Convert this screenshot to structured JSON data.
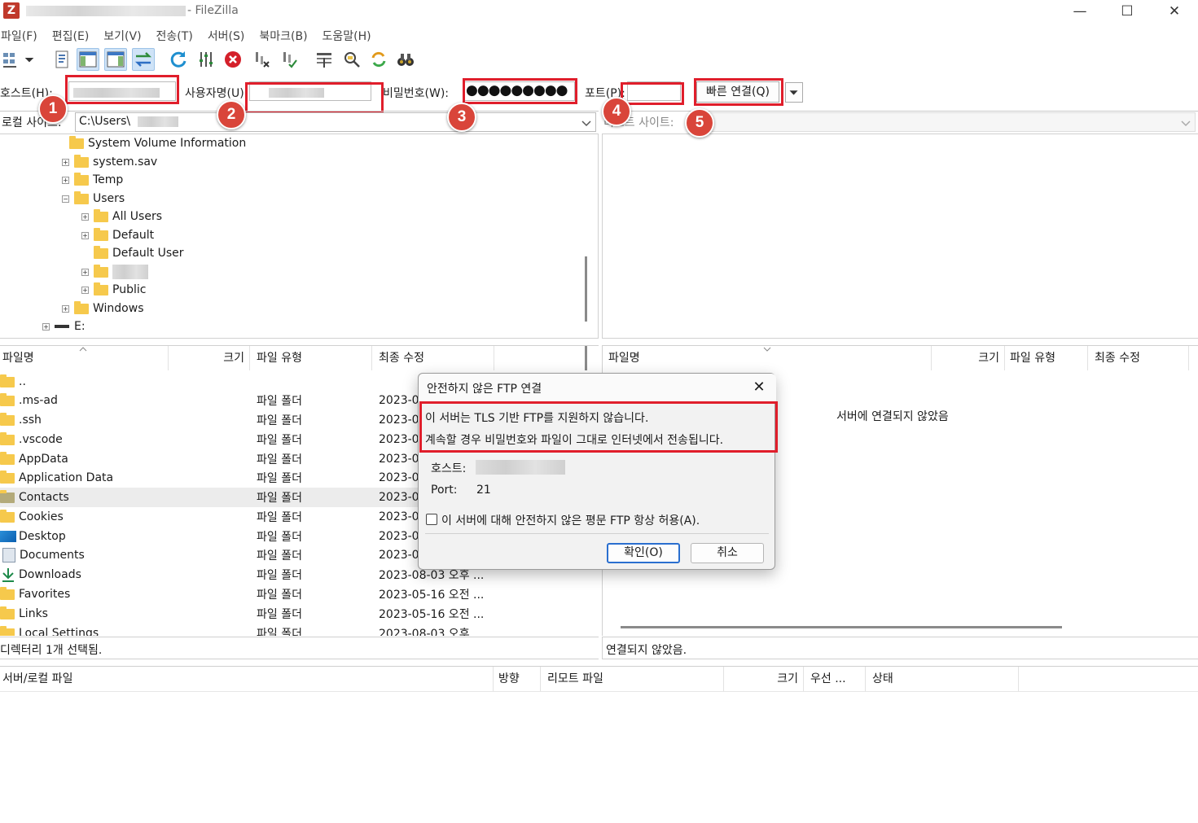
{
  "window": {
    "title": "- FileZilla",
    "logo": "Z",
    "controls": {
      "minimize": "—",
      "maximize": "☐",
      "close": "✕"
    }
  },
  "menu": [
    "파일(F)",
    "편집(E)",
    "보기(V)",
    "전송(T)",
    "서버(S)",
    "북마크(B)",
    "도움말(H)"
  ],
  "toolbar": {
    "icons": [
      "site-manager-icon",
      "dropdown-arrow-icon",
      "message-log-icon",
      "local-tree-icon",
      "remote-tree-icon",
      "transfer-queue-icon",
      "refresh-icon",
      "process-queue-icon",
      "cancel-icon",
      "disconnect-icon",
      "reconnect-icon",
      "directory-listing-filter-icon",
      "toggle-sync-icon",
      "sync-browse-icon",
      "search-icon"
    ]
  },
  "quickconnect": {
    "host_label": "호스트(H):",
    "user_label": "사용자명(U):",
    "password_label": "비밀번호(W):",
    "password_value": "●●●●●●●●●",
    "port_label": "포트(P):",
    "connect_button": "빠른 연결(Q)"
  },
  "badges": [
    "1",
    "2",
    "3",
    "4",
    "5"
  ],
  "local": {
    "site_label": "로컬 사이트:",
    "path": "C:\\Users\\",
    "tree": [
      {
        "label": "System Volume Information",
        "level": 1,
        "expander": ""
      },
      {
        "label": "system.sav",
        "level": 1,
        "expander": "+"
      },
      {
        "label": "Temp",
        "level": 1,
        "expander": "+"
      },
      {
        "label": "Users",
        "level": 1,
        "expander": "−"
      },
      {
        "label": "All Users",
        "level": 2,
        "expander": "+"
      },
      {
        "label": "Default",
        "level": 2,
        "expander": "+"
      },
      {
        "label": "Default User",
        "level": 2,
        "expander": ""
      },
      {
        "label": "",
        "level": 2,
        "expander": "+"
      },
      {
        "label": "Public",
        "level": 2,
        "expander": "+"
      },
      {
        "label": "Windows",
        "level": 1,
        "expander": "+"
      },
      {
        "label": "E:",
        "level": 0,
        "expander": "+"
      }
    ],
    "columns": {
      "name": "파일명",
      "size": "크기",
      "type": "파일 유형",
      "modified": "최종 수정"
    },
    "files": [
      {
        "name": "..",
        "type": "",
        "date": "",
        "icon": "folder-icon"
      },
      {
        "name": ".ms-ad",
        "type": "파일 폴더",
        "date": "2023-0",
        "icon": "folder-icon"
      },
      {
        "name": ".ssh",
        "type": "파일 폴더",
        "date": "2023-0",
        "icon": "folder-icon"
      },
      {
        "name": ".vscode",
        "type": "파일 폴더",
        "date": "2023-0",
        "icon": "folder-icon"
      },
      {
        "name": "AppData",
        "type": "파일 폴더",
        "date": "2023-0",
        "icon": "folder-icon"
      },
      {
        "name": "Application Data",
        "type": "파일 폴더",
        "date": "2023-0",
        "icon": "folder-icon"
      },
      {
        "name": "Contacts",
        "type": "파일 폴더",
        "date": "2023-0",
        "icon": "contacts-folder-icon"
      },
      {
        "name": "Cookies",
        "type": "파일 폴더",
        "date": "2023-0",
        "icon": "folder-icon"
      },
      {
        "name": "Desktop",
        "type": "파일 폴더",
        "date": "2023-0",
        "icon": "desktop-folder-icon"
      },
      {
        "name": "Documents",
        "type": "파일 폴더",
        "date": "2023-0",
        "icon": "documents-folder-icon"
      },
      {
        "name": "Downloads",
        "type": "파일 폴더",
        "date": "2023-08-03 오후 ...",
        "icon": "downloads-folder-icon"
      },
      {
        "name": "Favorites",
        "type": "파일 폴더",
        "date": "2023-05-16 오전 ...",
        "icon": "folder-icon"
      },
      {
        "name": "Links",
        "type": "파일 폴더",
        "date": "2023-05-16 오전 ...",
        "icon": "folder-icon"
      },
      {
        "name": "Local Settings",
        "type": "파일 폴더",
        "date": "2023-08-03 오후",
        "icon": "folder-icon"
      }
    ],
    "status": "디렉터리 1개 선택됨."
  },
  "remote": {
    "site_label": "리모트 사이트:",
    "columns": {
      "name": "파일명",
      "size": "크기",
      "type": "파일 유형",
      "modified": "최종 수정"
    },
    "empty_message": "서버에 연결되지 않았음",
    "status": "연결되지 않았음."
  },
  "queue": {
    "columns": {
      "file": "서버/로컬 파일",
      "direction": "방향",
      "remote": "리모트 파일",
      "size": "크기",
      "priority": "우선 ...",
      "status": "상태"
    }
  },
  "dialog": {
    "title": "안전하지 않은 FTP 연결",
    "line1": "이 서버는 TLS 기반 FTP를 지원하지 않습니다.",
    "line2": "계속할 경우 비밀번호와 파일이 그대로 인터넷에서 전송됩니다.",
    "host_label": "호스트:",
    "port_label": "Port:",
    "port_value": "21",
    "checkbox_label": "이 서버에 대해 안전하지 않은 평문 FTP 항상 허용(A).",
    "ok": "확인(O)",
    "cancel": "취소"
  },
  "colors": {
    "highlight_red": "#e01e2b",
    "badge_red": "#d9453a",
    "folder_yellow": "#f6c94c",
    "focus_blue": "#2a6fcf"
  }
}
